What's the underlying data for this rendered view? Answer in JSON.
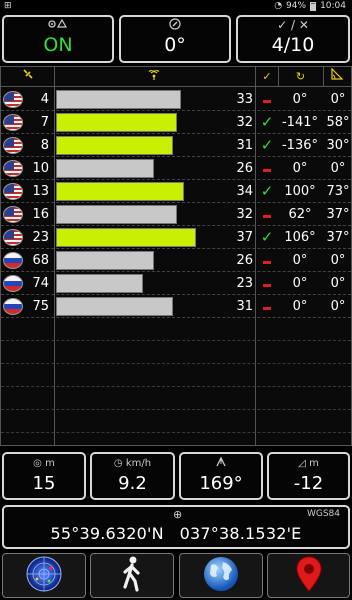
{
  "status_bar": {
    "battery": "94%",
    "time": "10:04"
  },
  "top_boxes": {
    "status": {
      "icon": "gps-signal-icon",
      "value": "ON",
      "value_color": "#33dd33"
    },
    "bearing": {
      "icon": "compass-icon",
      "value": "0°"
    },
    "satellites": {
      "icon": "check-slash-icon",
      "label": "✓ / ✕",
      "value": "4/10"
    }
  },
  "table": {
    "header_icons": [
      "satellite-icon",
      "signal-icon",
      "check-icon",
      "azimuth-icon",
      "elevation-icon"
    ],
    "rows": [
      {
        "flag": "us",
        "prn": "4",
        "snr": "33",
        "snr_level": 33,
        "used": false,
        "azimuth": "0°",
        "elevation": "0°"
      },
      {
        "flag": "us",
        "prn": "7",
        "snr": "32",
        "snr_level": 32,
        "used": true,
        "azimuth": "-141°",
        "elevation": "58°"
      },
      {
        "flag": "us",
        "prn": "8",
        "snr": "31",
        "snr_level": 31,
        "used": true,
        "azimuth": "-136°",
        "elevation": "30°"
      },
      {
        "flag": "us",
        "prn": "10",
        "snr": "26",
        "snr_level": 26,
        "used": false,
        "azimuth": "0°",
        "elevation": "0°"
      },
      {
        "flag": "us",
        "prn": "13",
        "snr": "34",
        "snr_level": 34,
        "used": true,
        "azimuth": "100°",
        "elevation": "73°"
      },
      {
        "flag": "us",
        "prn": "16",
        "snr": "32",
        "snr_level": 32,
        "used": false,
        "azimuth": "62°",
        "elevation": "37°"
      },
      {
        "flag": "us",
        "prn": "23",
        "snr": "37",
        "snr_level": 37,
        "used": true,
        "azimuth": "106°",
        "elevation": "37°"
      },
      {
        "flag": "ru",
        "prn": "68",
        "snr": "26",
        "snr_level": 26,
        "used": false,
        "azimuth": "0°",
        "elevation": "0°"
      },
      {
        "flag": "ru",
        "prn": "74",
        "snr": "23",
        "snr_level": 23,
        "used": false,
        "azimuth": "0°",
        "elevation": "0°"
      },
      {
        "flag": "ru",
        "prn": "75",
        "snr": "31",
        "snr_level": 31,
        "used": false,
        "azimuth": "0°",
        "elevation": "0°"
      }
    ],
    "snr_max": 45,
    "colors": {
      "used_bar": "#c8f000",
      "unused_bar": "#c8c8c8",
      "check": "#33dd33",
      "dash": "#e02020",
      "header": "#e8d000"
    }
  },
  "stats": {
    "altitude": {
      "unit": "m",
      "value": "15"
    },
    "speed": {
      "unit": "km/h",
      "value": "9.2"
    },
    "course": {
      "value": "169°"
    },
    "vertical": {
      "unit": "m",
      "value": "-12"
    }
  },
  "coordinates": {
    "datum": "WGS84",
    "lat": "55°39.6320'N",
    "lon": "037°38.1532'E"
  },
  "nav": [
    "radar-icon",
    "walking-person-icon",
    "globe-icon",
    "map-pin-icon"
  ]
}
